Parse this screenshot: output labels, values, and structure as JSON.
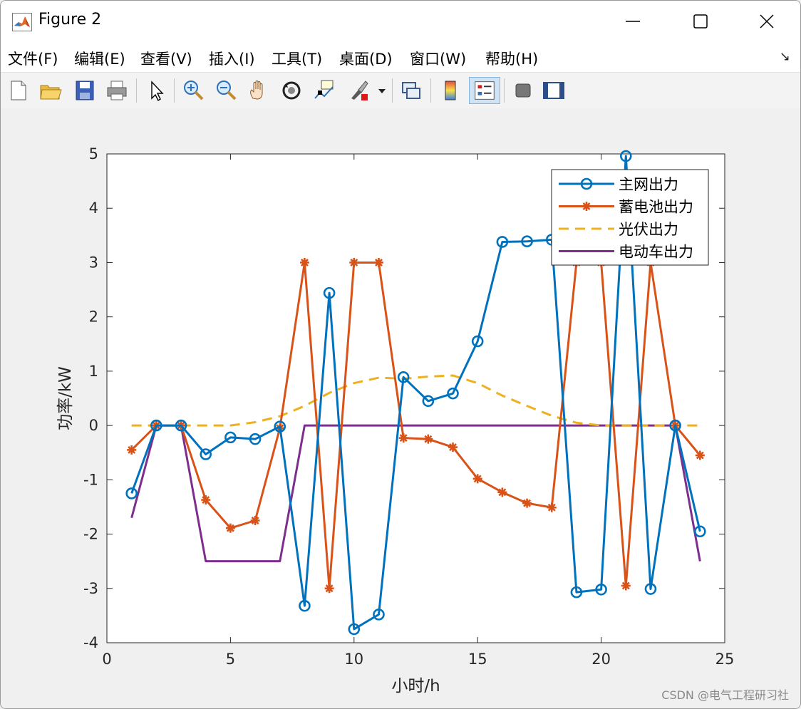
{
  "window": {
    "title": "Figure 2",
    "controls": {
      "minimize": "minimize",
      "maximize": "maximize",
      "close": "close"
    }
  },
  "menu": [
    "文件(F)",
    "编辑(E)",
    "查看(V)",
    "插入(I)",
    "工具(T)",
    "桌面(D)",
    "窗口(W)",
    "帮助(H)"
  ],
  "toolbar": {
    "icons": [
      "new-figure-icon",
      "open-file-icon",
      "save-icon",
      "print-icon",
      "select-arrow-icon",
      "zoom-in-icon",
      "zoom-out-icon",
      "pan-hand-icon",
      "rotate-3d-icon",
      "data-cursor-icon",
      "brush-icon",
      "brush-dropdown-icon",
      "link-plot-icon",
      "colorbar-icon",
      "legend-icon",
      "hide-plot-tools-icon",
      "show-plot-tools-icon"
    ],
    "active": "legend-icon"
  },
  "chart_data": {
    "type": "line",
    "xlabel": "小时/h",
    "ylabel": "功率/kW",
    "xlim": [
      0,
      25
    ],
    "ylim": [
      -4,
      5
    ],
    "xticks": [
      0,
      5,
      10,
      15,
      20,
      25
    ],
    "yticks": [
      -4,
      -3,
      -2,
      -1,
      0,
      1,
      2,
      3,
      4,
      5
    ],
    "grid": false,
    "legend_position": "top-right",
    "x": [
      1,
      2,
      3,
      4,
      5,
      6,
      7,
      8,
      9,
      10,
      11,
      12,
      13,
      14,
      15,
      16,
      17,
      18,
      19,
      20,
      21,
      22,
      23,
      24
    ],
    "series": [
      {
        "name": "主网出力",
        "color": "#0072bd",
        "marker": "circle",
        "dash": "solid",
        "values": [
          -1.25,
          0,
          0,
          -0.53,
          -0.22,
          -0.25,
          -0.02,
          -3.32,
          2.44,
          -3.75,
          -3.48,
          0.89,
          0.45,
          0.59,
          1.55,
          3.38,
          3.39,
          3.42,
          -3.07,
          -3.02,
          4.96,
          -3.01,
          0,
          -1.95
        ]
      },
      {
        "name": "蓄电池出力",
        "color": "#d95319",
        "marker": "asterisk",
        "dash": "solid",
        "values": [
          -0.45,
          0,
          0,
          -1.37,
          -1.89,
          -1.75,
          -0.05,
          3.0,
          -3.0,
          3.0,
          3.0,
          -0.23,
          -0.25,
          -0.4,
          -0.98,
          -1.23,
          -1.43,
          -1.51,
          3.0,
          3.0,
          -2.95,
          3.0,
          0,
          -0.55
        ]
      },
      {
        "name": "光伏出力",
        "color": "#edb120",
        "marker": "none",
        "dash": "dashed",
        "values": [
          0,
          0,
          0,
          0,
          0,
          0.06,
          0.17,
          0.36,
          0.6,
          0.78,
          0.88,
          0.86,
          0.9,
          0.92,
          0.78,
          0.55,
          0.36,
          0.18,
          0.05,
          0,
          0,
          0,
          0,
          0
        ]
      },
      {
        "name": "电动车出力",
        "color": "#7e2f8e",
        "marker": "none",
        "dash": "solid",
        "values": [
          -1.7,
          0,
          0,
          -2.5,
          -2.5,
          -2.5,
          -2.5,
          0,
          0,
          0,
          0,
          0,
          0,
          0,
          0,
          0,
          0,
          0,
          0,
          0,
          0,
          0,
          0,
          -2.5
        ]
      }
    ]
  },
  "watermark": "CSDN @电气工程研习社"
}
